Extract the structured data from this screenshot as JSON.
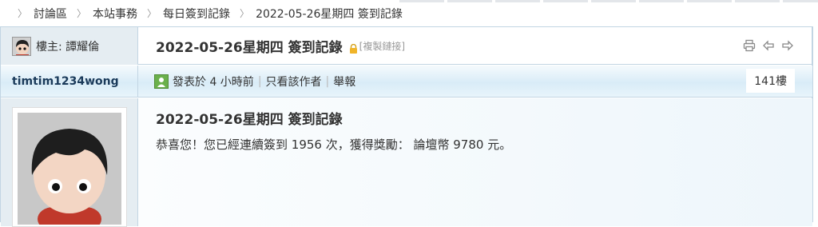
{
  "breadcrumb": {
    "items": [
      "討論區",
      "本站事務",
      "每日簽到記錄",
      "2022-05-26星期四 簽到記錄"
    ]
  },
  "header": {
    "host_label": "樓主: 譚耀倫",
    "title": "2022-05-26星期四 簽到記錄",
    "copy_link": "[複製鏈接]"
  },
  "author_bar": {
    "author": "timtim1234wong",
    "posted": "發表於 4 小時前",
    "only_author": "只看該作者",
    "report": "舉報",
    "floor": "141樓"
  },
  "post": {
    "title": "2022-05-26星期四 簽到記錄",
    "body": "恭喜您！您已經連續簽到 1956 次，獲得獎勵： 論壇幣 9780 元。"
  },
  "icons": {
    "print": "print-icon",
    "prev": "arrow-left-icon",
    "next": "arrow-right-icon",
    "lock": "lock-icon"
  }
}
